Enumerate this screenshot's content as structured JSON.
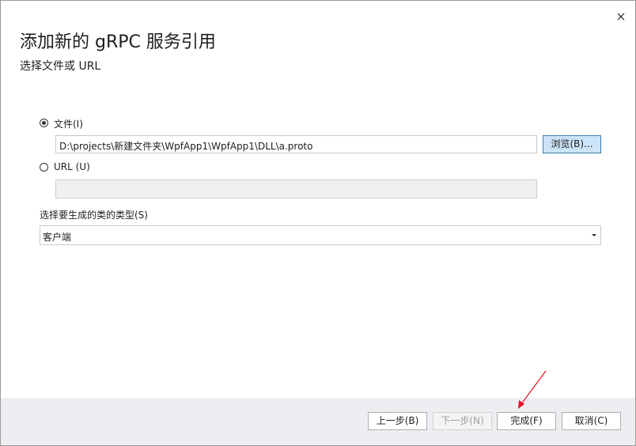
{
  "dialog": {
    "title": "添加新的 gRPC 服务引用",
    "subtitle": "选择文件或 URL",
    "close_icon": "close-icon"
  },
  "source": {
    "file_option_label": "文件(I)",
    "file_option_selected": true,
    "file_path": "D:\\projects\\新建文件夹\\WpfApp1\\WpfApp1\\DLL\\a.proto",
    "browse_label": "浏览(B)...",
    "url_option_label": "URL (U)",
    "url_option_selected": false,
    "url_value": ""
  },
  "class_type": {
    "label": "选择要生成的类的类型(S)",
    "selected": "客户端"
  },
  "footer": {
    "prev_label": "上一步(B)",
    "next_label": "下一步(N)",
    "finish_label": "完成(F)",
    "cancel_label": "取消(C)"
  },
  "colors": {
    "annotation_arrow": "#e81123",
    "browse_button_bg": "#cce4f7",
    "footer_bg": "#eeeef2"
  }
}
